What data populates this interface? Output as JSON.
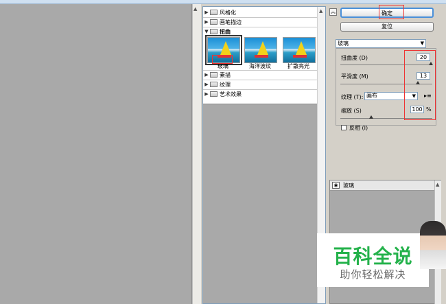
{
  "filter_tree": {
    "categories": [
      {
        "label": "风格化",
        "expanded": false
      },
      {
        "label": "画笔描边",
        "expanded": false
      },
      {
        "label": "扭曲",
        "expanded": true
      },
      {
        "label": "素描",
        "expanded": false
      },
      {
        "label": "纹理",
        "expanded": false
      },
      {
        "label": "艺术效果",
        "expanded": false
      }
    ],
    "distort_filters": [
      {
        "label": "玻璃",
        "selected": true
      },
      {
        "label": "海洋波纹",
        "selected": false
      },
      {
        "label": "扩散亮光",
        "selected": false
      }
    ]
  },
  "buttons": {
    "ok": "确定",
    "reset": "复位"
  },
  "settings": {
    "filter_select": "玻璃",
    "distortion": {
      "label": "扭曲度 (D)",
      "value": "20"
    },
    "smoothness": {
      "label": "平滑度 (M)",
      "value": "13"
    },
    "texture": {
      "label": "纹理 (T):",
      "value": "画布"
    },
    "scaling": {
      "label": "缩放 (S)",
      "value": "100",
      "unit": "%"
    },
    "invert": {
      "label": "反相 (I)",
      "checked": false
    }
  },
  "layers": {
    "items": [
      {
        "name": "玻璃",
        "visible": true
      }
    ]
  },
  "watermark": {
    "title": "百科全说",
    "subtitle": "助你轻松解决"
  },
  "colors": {
    "highlight_red": "#e33333",
    "ok_border": "#4a90d9",
    "watermark_green": "#24b24b"
  }
}
